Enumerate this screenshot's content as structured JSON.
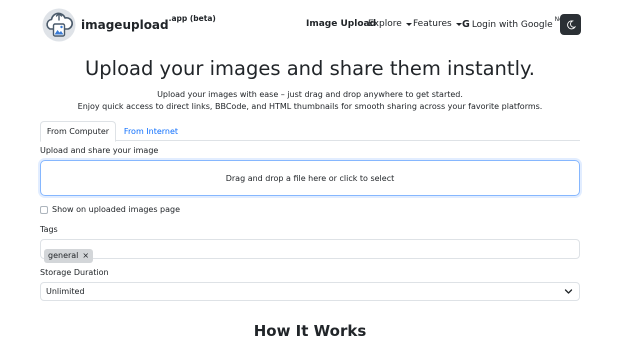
{
  "nav": {
    "brand": "imageupload",
    "brand_suffix": ".app (beta)",
    "image_upload": "Image Upload",
    "explore": "Explore",
    "features": "Features",
    "login": "Login with Google",
    "login_badge": "New",
    "google_glyph": "G"
  },
  "hero": {
    "title": "Upload your images and share them instantly.",
    "line1": "Upload your images with ease – just drag and drop anywhere to get started.",
    "line2": "Enjoy quick access to direct links, BBCode, and HTML thumbnails for smooth sharing across your favorite platforms."
  },
  "tabs": [
    {
      "label": "From Computer",
      "active": true
    },
    {
      "label": "From Internet",
      "active": false
    }
  ],
  "upload": {
    "label": "Upload and share your image",
    "dropzone": "Drag and drop a file here or click to select"
  },
  "show_on_page": {
    "label": "Show on uploaded images page",
    "checked": false
  },
  "tags": {
    "label": "Tags",
    "items": [
      "general"
    ],
    "remove_glyph": "×"
  },
  "storage": {
    "label": "Storage Duration",
    "value": "Unlimited"
  },
  "how_it_works": "How It Works",
  "colors": {
    "link": "#0d6efd",
    "dark_button": "#2b3035",
    "focus_border": "#86b7fe"
  },
  "icons": [
    "cloud-upload-logo-icon",
    "caret-down-icon",
    "google-icon",
    "moon-icon",
    "chevron-down-icon"
  ]
}
